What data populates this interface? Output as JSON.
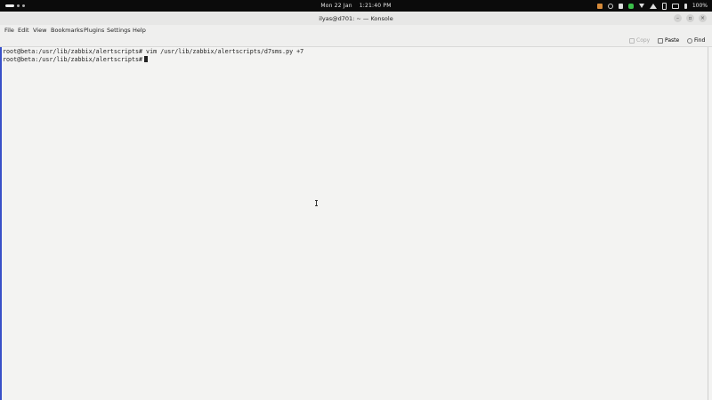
{
  "topbar": {
    "date": "Mon 22 Jan",
    "time": "1:21:40 PM",
    "battery": "100%"
  },
  "window": {
    "title": "ilyas@d701: ~ — Konsole"
  },
  "menu": [
    "File",
    "Edit",
    "View",
    "Bookmarks",
    "Plugins",
    "Settings",
    "Help"
  ],
  "toolbar": {
    "copy": "Copy",
    "paste": "Paste",
    "find": "Find"
  },
  "terminal": {
    "lines": [
      "root@beta:/usr/lib/zabbix/alertscripts# vim /usr/lib/zabbix/alertscripts/d7sms.py +7",
      "root@beta:/usr/lib/zabbix/alertscripts#"
    ]
  }
}
